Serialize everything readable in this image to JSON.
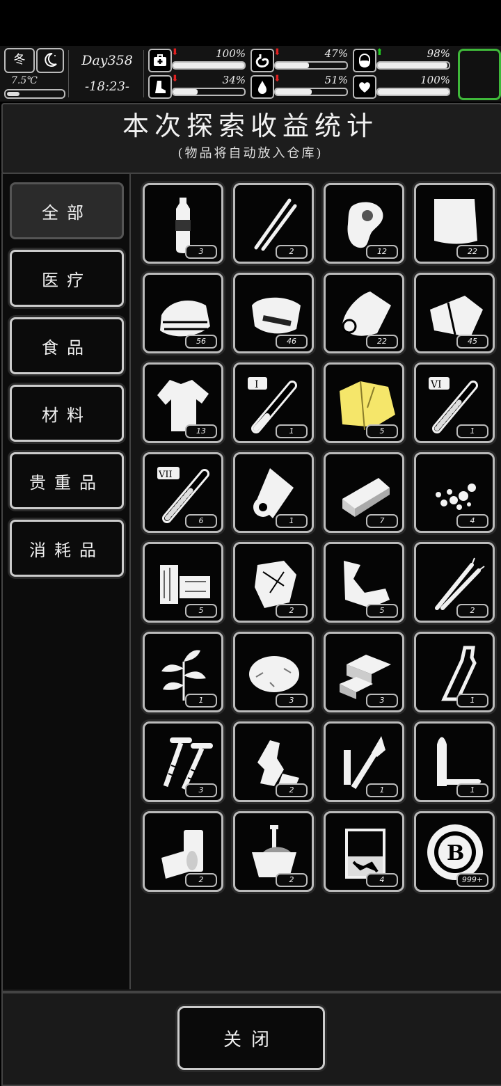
{
  "hud": {
    "season": "冬",
    "temperature": "7.5℃",
    "day": "Day358",
    "time": "-18:23-",
    "stats": [
      {
        "name": "health",
        "icon": "medkit-icon",
        "trend": "down",
        "value": "100%",
        "level": 1.0
      },
      {
        "name": "hunger",
        "icon": "stomach-icon",
        "trend": "down",
        "value": "47%",
        "level": 0.47
      },
      {
        "name": "sanity",
        "icon": "pill-icon",
        "trend": "up",
        "value": "98%",
        "level": 0.98
      },
      {
        "name": "stamina",
        "icon": "foot-icon",
        "trend": "down",
        "value": "34%",
        "level": 0.34
      },
      {
        "name": "thirst",
        "icon": "water-drop-icon",
        "trend": "down",
        "value": "51%",
        "level": 0.51
      },
      {
        "name": "mood",
        "icon": "heart-icon",
        "trend": "none",
        "value": "100%",
        "level": 1.0
      }
    ],
    "colors": {
      "up": "#22cc22",
      "down": "#e02020",
      "portrait_border": "#3fb83a"
    }
  },
  "header": {
    "title": "本次探索收益统计",
    "subtitle": "(物品将自动放入仓库)"
  },
  "categories": [
    "全部",
    "医疗",
    "食品",
    "材料",
    "贵重品",
    "消耗品"
  ],
  "active_category": "全部",
  "items": [
    {
      "icon": "water-bottle-icon",
      "count": "3"
    },
    {
      "icon": "tweezers-icon",
      "count": "2"
    },
    {
      "icon": "raw-meat-icon",
      "count": "12"
    },
    {
      "icon": "paper-sheet-icon",
      "count": "22"
    },
    {
      "icon": "folded-cloth-icon",
      "count": "56"
    },
    {
      "icon": "bread-icon",
      "count": "46"
    },
    {
      "icon": "towel-icon",
      "count": "22"
    },
    {
      "icon": "fabric-scrap-icon",
      "count": "45"
    },
    {
      "icon": "torn-shirt-icon",
      "count": "13"
    },
    {
      "icon": "test-tube-i-icon",
      "count": "1"
    },
    {
      "icon": "yellow-raincoat-icon",
      "count": "5"
    },
    {
      "icon": "test-tube-vi-icon",
      "count": "1"
    },
    {
      "icon": "test-tube-vii-icon",
      "count": "6"
    },
    {
      "icon": "paper-roll-icon",
      "count": "1"
    },
    {
      "icon": "brick-icon",
      "count": "7"
    },
    {
      "icon": "gravel-icon",
      "count": "4"
    },
    {
      "icon": "wood-blocks-icon",
      "count": "5"
    },
    {
      "icon": "crumpled-paper-icon",
      "count": "2"
    },
    {
      "icon": "scrap-metal-icon",
      "count": "5"
    },
    {
      "icon": "wires-icon",
      "count": "2"
    },
    {
      "icon": "herb-plant-icon",
      "count": "1"
    },
    {
      "icon": "cotton-icon",
      "count": "3"
    },
    {
      "icon": "stone-blocks-icon",
      "count": "3"
    },
    {
      "icon": "bottle-icon",
      "count": "1"
    },
    {
      "icon": "screws-icon",
      "count": "3"
    },
    {
      "icon": "plastic-trash-icon",
      "count": "2"
    },
    {
      "icon": "soldering-tool-icon",
      "count": "1"
    },
    {
      "icon": "bullet-icon",
      "count": "1"
    },
    {
      "icon": "tin-cans-icon",
      "count": "2"
    },
    {
      "icon": "bucket-icon",
      "count": "2"
    },
    {
      "icon": "beaker-icon",
      "count": "4"
    },
    {
      "icon": "coin-icon",
      "count": "999+",
      "coin_letter": "B"
    }
  ],
  "footer": {
    "close_label": "关闭"
  }
}
